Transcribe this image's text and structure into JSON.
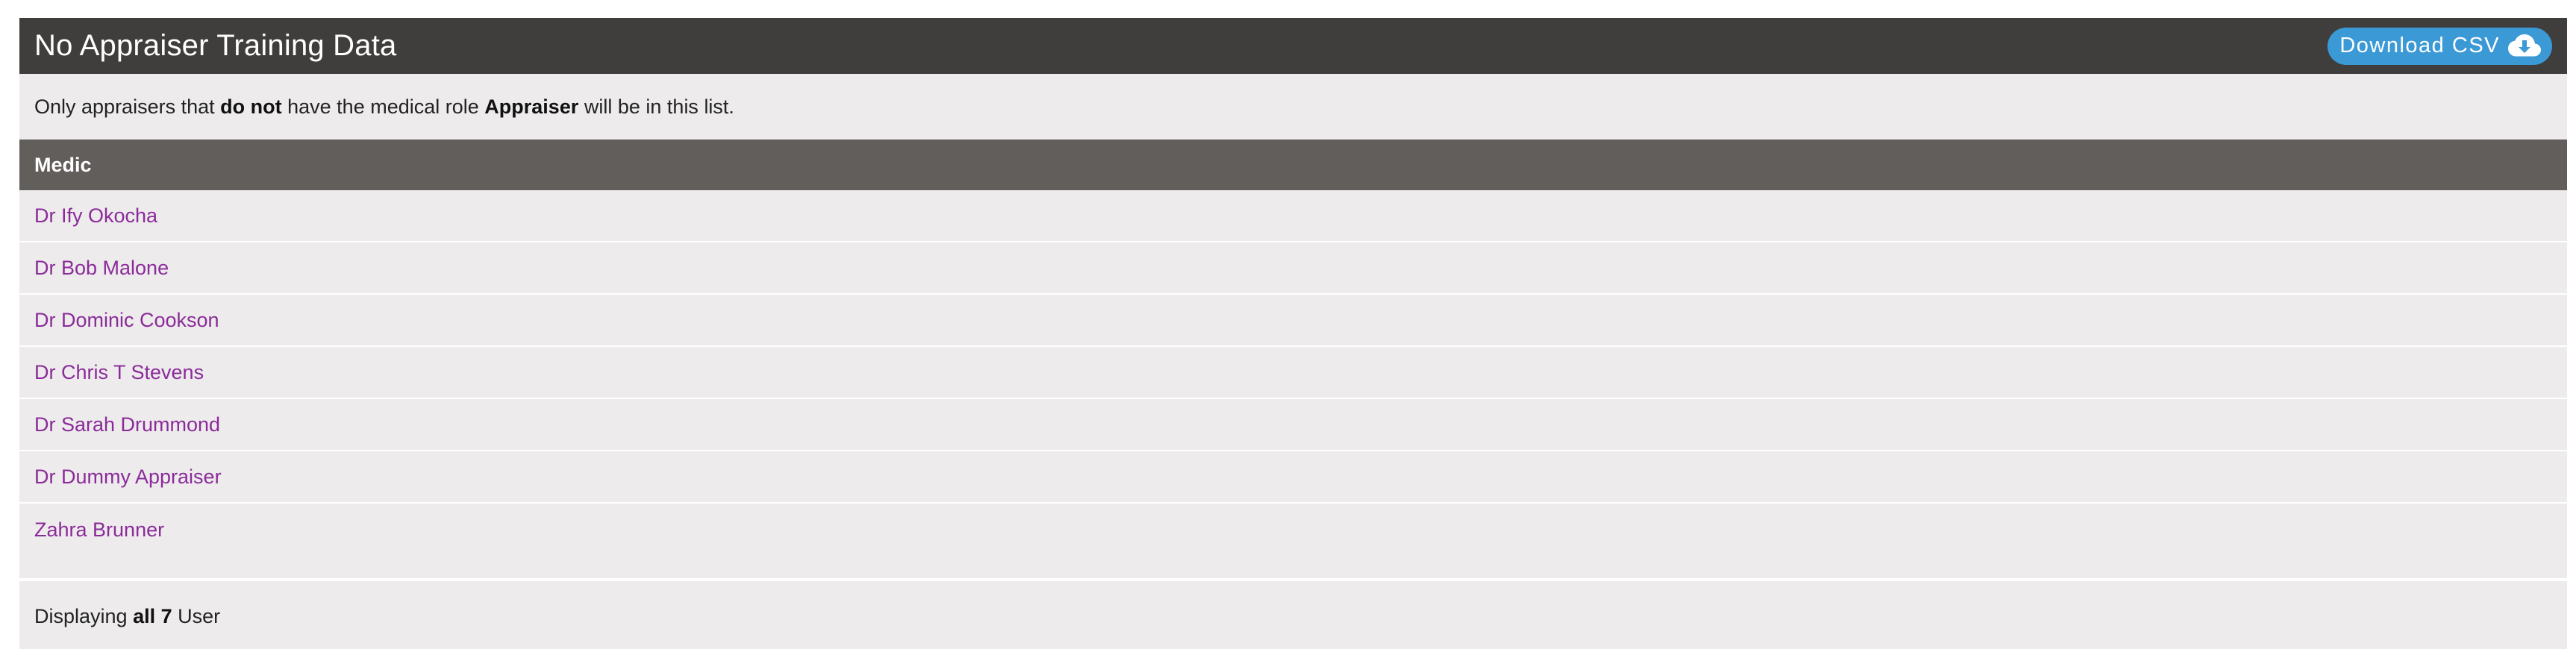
{
  "panel": {
    "title": "No Appraiser Training Data",
    "download_label": "Download CSV",
    "download_icon": "cloud-download-icon"
  },
  "note": {
    "prefix": "Only appraisers that ",
    "emphasis1": "do not",
    "middle": " have the medical role ",
    "emphasis2": "Appraiser",
    "suffix": " will be in this list."
  },
  "table": {
    "column_header": "Medic",
    "rows": [
      {
        "name": "Dr Ify Okocha"
      },
      {
        "name": "Dr Bob Malone"
      },
      {
        "name": "Dr Dominic Cookson"
      },
      {
        "name": "Dr Chris T Stevens"
      },
      {
        "name": "Dr Sarah Drummond"
      },
      {
        "name": "Dr Dummy Appraiser"
      },
      {
        "name": "Zahra Brunner"
      }
    ]
  },
  "footer": {
    "prefix": "Displaying ",
    "emphasis": "all 7",
    "suffix": " User"
  },
  "colors": {
    "header_bg": "#403e3d",
    "table_head_bg": "#625e5c",
    "panel_bg": "#edebec",
    "link": "#8b2b9a",
    "button": "#3b99d6"
  }
}
